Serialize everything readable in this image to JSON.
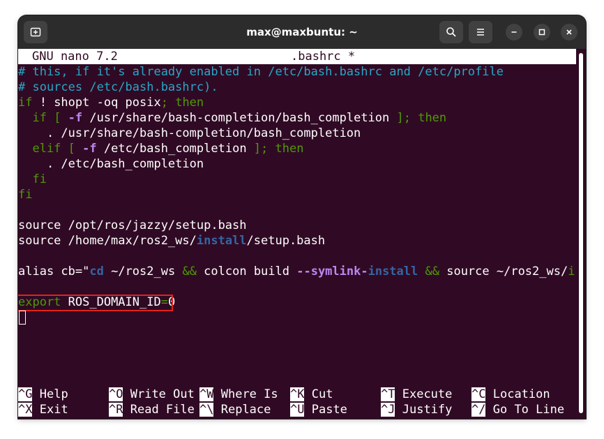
{
  "window": {
    "title": "max@maxbuntu: ~",
    "new_tab_icon": "new-tab-icon",
    "search_icon": "search-icon",
    "menu_icon": "hamburger-menu-icon",
    "minimize_icon": "minimize-icon",
    "maximize_icon": "maximize-icon",
    "close_icon": "close-icon"
  },
  "nano": {
    "version": "GNU nano 7.2",
    "filename": ".bashrc *"
  },
  "lines": {
    "l1": "# this, if it's already enabled in /etc/bash.bashrc and /etc/profile",
    "l2": "# sources /etc/bash.bashrc).",
    "l3_kw": "if",
    "l3_a": " ! shopt -oq posix",
    "l3_semi": ";",
    "l3_then": " then",
    "l4_if": "  if",
    "l4_br": " [ ",
    "l4_flag": "-f",
    "l4_path": " /usr/share/bash-completion/bash_completion ",
    "l4_end": "]; then",
    "l5": "    . /usr/share/bash-completion/bash_completion",
    "l6_elif": "  elif",
    "l6_br": " [ ",
    "l6_flag": "-f",
    "l6_path": " /etc/bash_completion ",
    "l6_end": "]; then",
    "l7": "    . /etc/bash_completion",
    "l8": "  fi",
    "l9": "fi",
    "l11": "source /opt/ros/jazzy/setup.bash",
    "l12_a": "source /home/max/ros2_ws/",
    "l12_b": "install",
    "l12_c": "/setup.bash",
    "l14_a": "alias cb=",
    "l14_q": "\"",
    "l14_cd": "cd",
    "l14_b": " ~/ros2_ws ",
    "l14_and1": "&&",
    "l14_c": " colcon build ",
    "l14_flag": "--symlink-",
    "l14_install": "install",
    "l14_d": " ",
    "l14_and2": "&&",
    "l14_e": " source ~/ros2_ws/",
    "l14_in": "in",
    "l14_more": ">",
    "l16_export": "export",
    "l16_var": " ROS_DOMAIN_ID",
    "l16_eq": "=",
    "l16_val": "0"
  },
  "shortcuts": [
    {
      "key": "^G",
      "label": "Help"
    },
    {
      "key": "^O",
      "label": "Write Out"
    },
    {
      "key": "^W",
      "label": "Where Is"
    },
    {
      "key": "^K",
      "label": "Cut"
    },
    {
      "key": "^T",
      "label": "Execute"
    },
    {
      "key": "^C",
      "label": "Location"
    },
    {
      "key": "^X",
      "label": "Exit"
    },
    {
      "key": "^R",
      "label": "Read File"
    },
    {
      "key": "^\\",
      "label": "Replace"
    },
    {
      "key": "^U",
      "label": "Paste"
    },
    {
      "key": "^J",
      "label": "Justify"
    },
    {
      "key": "^/",
      "label": "Go To Line"
    }
  ]
}
